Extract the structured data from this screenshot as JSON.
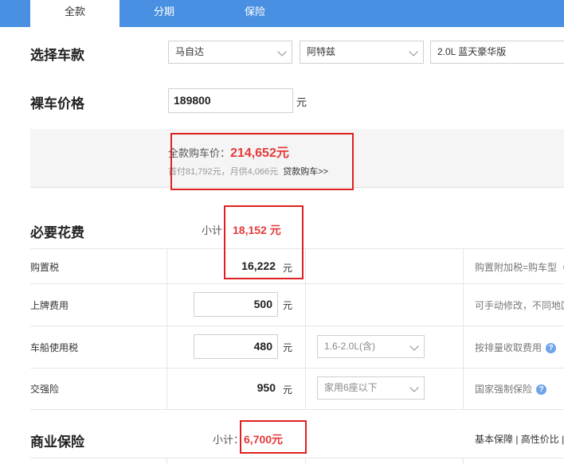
{
  "tabs": [
    {
      "label": "全款"
    },
    {
      "label": "分期"
    },
    {
      "label": "保险"
    }
  ],
  "select_model": {
    "title": "选择车款",
    "brand": "马自达",
    "series": "阿特兹",
    "variant": "2.0L 蓝天豪华版"
  },
  "bare_price": {
    "title": "裸车价格",
    "value": "189800",
    "unit": "元"
  },
  "full_price": {
    "label": "全款购车价：",
    "value": "214,652元",
    "loan_info": "首付81,792元，月供4,066元",
    "loan_link": "贷款购车>>"
  },
  "required_fees": {
    "title": "必要花费",
    "subtotal_label": "小计：",
    "subtotal_value": "18,152 元",
    "rows": [
      {
        "label": "购置税",
        "value": "16,222",
        "unit": "元",
        "note": "购置附加税=购车型（"
      },
      {
        "label": "上牌费用",
        "value": "500",
        "unit": "元",
        "note": "可手动修改，不同地区"
      },
      {
        "label": "车船使用税",
        "value": "480",
        "unit": "元",
        "select": "1.6-2.0L(含)",
        "note": "按排量收取费用"
      },
      {
        "label": "交强险",
        "value": "950",
        "unit": "元",
        "select": "家用6座以下",
        "note": "国家强制保险"
      }
    ]
  },
  "commercial_insurance": {
    "title": "商业保险",
    "subtotal_label": "小计：",
    "subtotal_value": "6,700元",
    "options": "基本保障 | 高性价比 |"
  }
}
